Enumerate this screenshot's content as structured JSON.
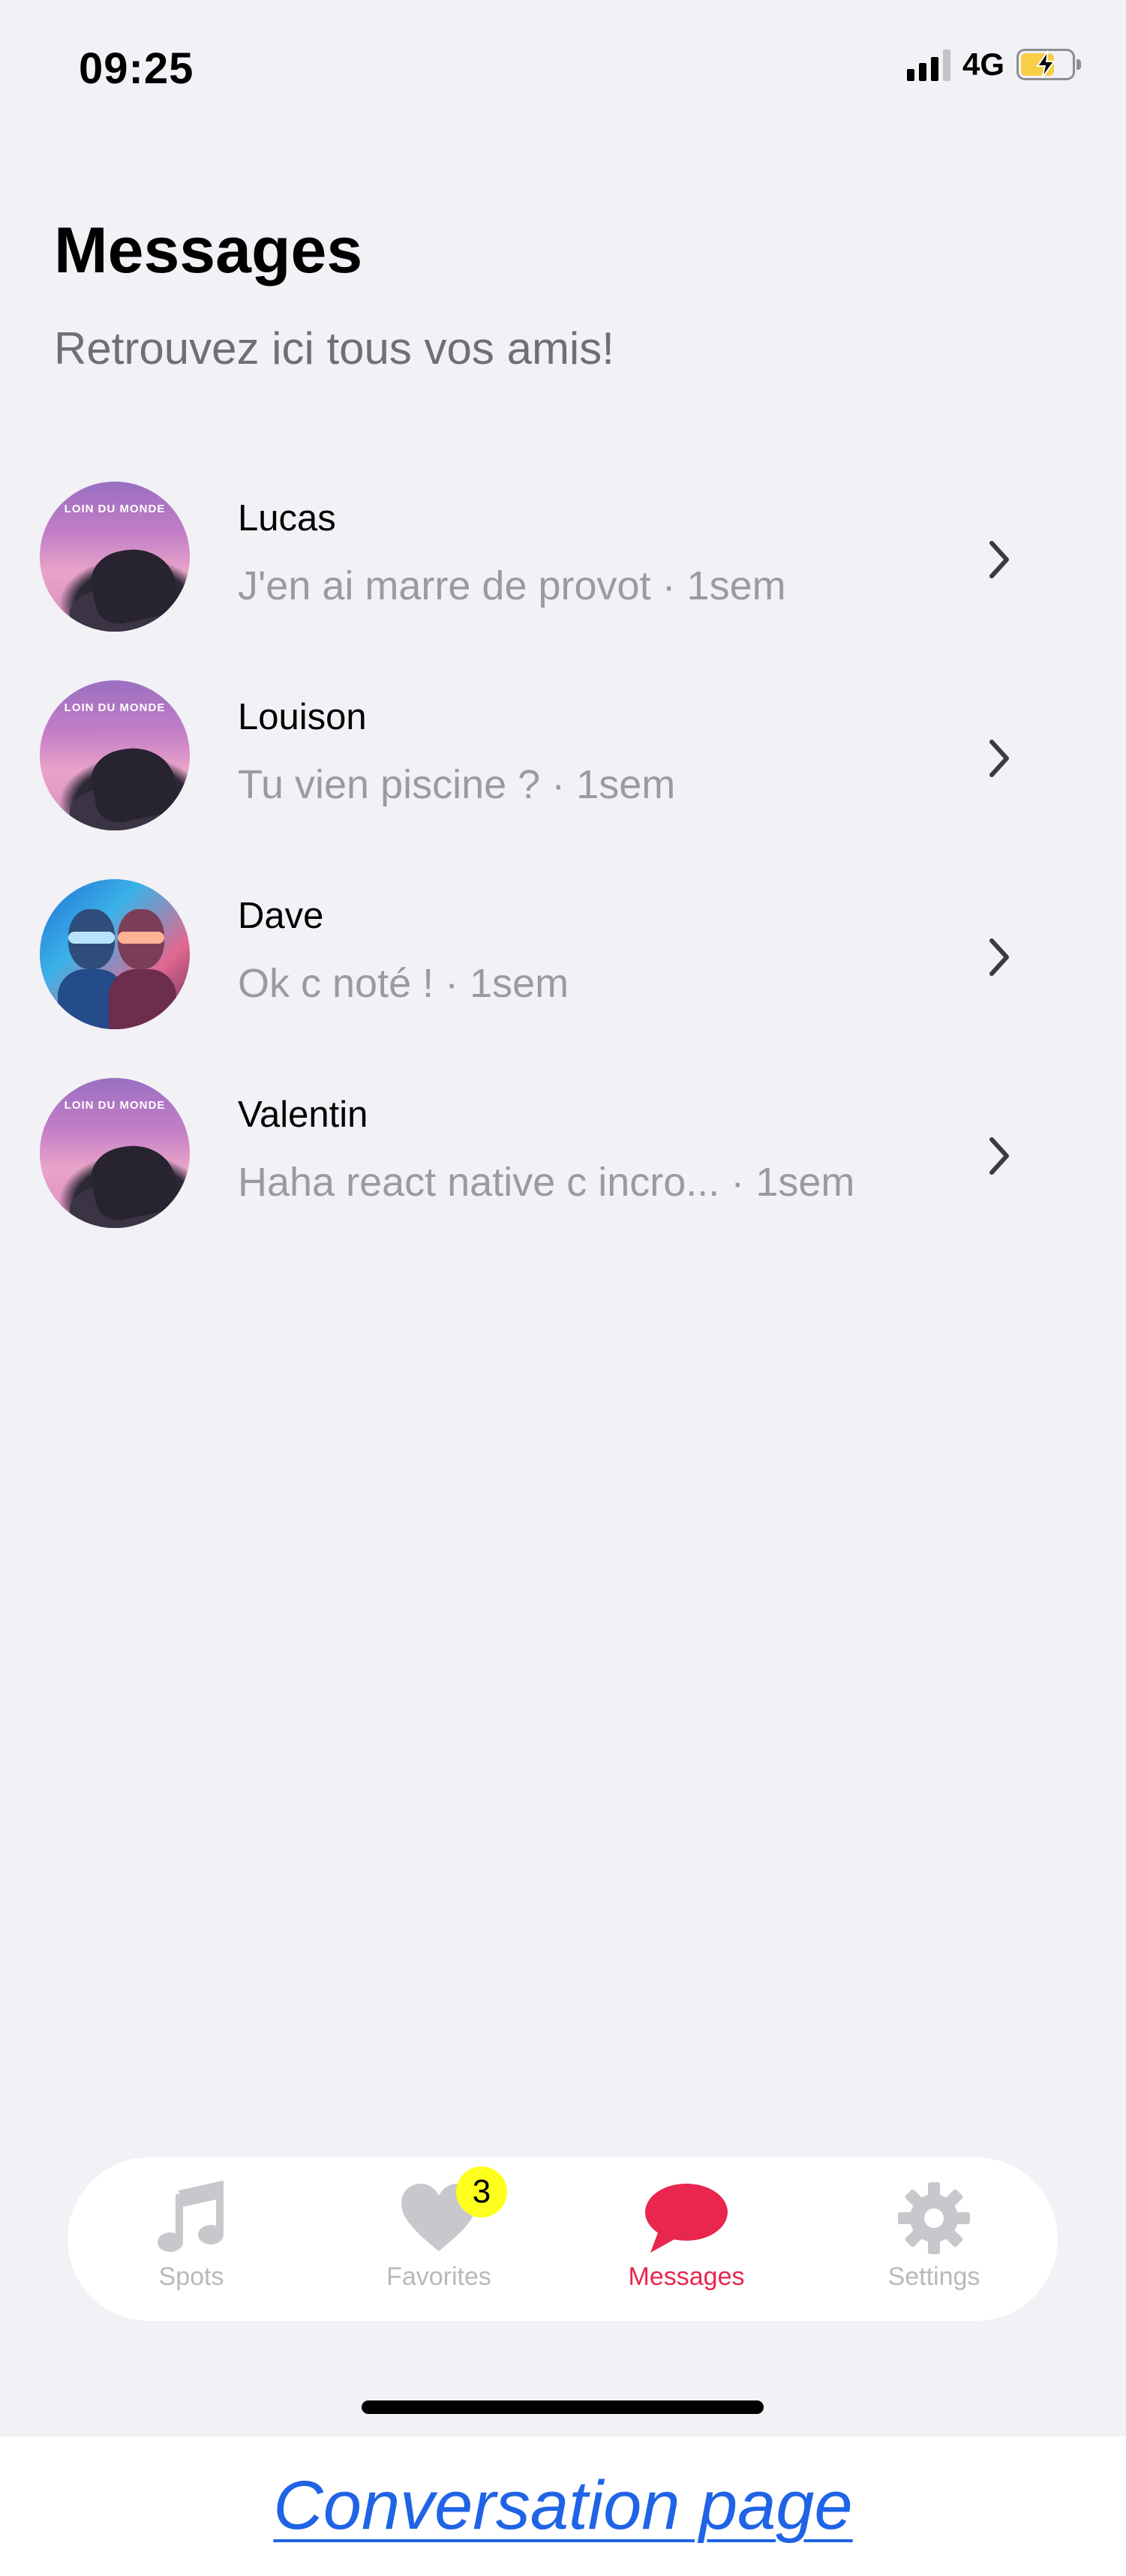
{
  "status_bar": {
    "time": "09:25",
    "network": "4G",
    "signal_bars_active": 3,
    "battery_charging": true
  },
  "header": {
    "title": "Messages",
    "subtitle": "Retrouvez ici tous vos amis!"
  },
  "conversations": [
    {
      "name": "Lucas",
      "preview": "J'en ai marre de provot · 1sem",
      "avatar": "album-cover"
    },
    {
      "name": "Louison",
      "preview": "Tu vien piscine ? · 1sem",
      "avatar": "album-cover"
    },
    {
      "name": "Dave",
      "preview": "Ok c noté ! · 1sem",
      "avatar": "duo-photo"
    },
    {
      "name": "Valentin",
      "preview": "Haha react native c incro...  · 1sem",
      "avatar": "album-cover"
    }
  ],
  "album_cover_text": "LOIN DU MONDE",
  "tab_bar": {
    "tabs": [
      {
        "label": "Spots",
        "icon": "music-note-icon",
        "active": false
      },
      {
        "label": "Favorites",
        "icon": "heart-icon",
        "active": false,
        "badge": "3"
      },
      {
        "label": "Messages",
        "icon": "chat-bubble-icon",
        "active": true
      },
      {
        "label": "Settings",
        "icon": "gear-icon",
        "active": false
      }
    ]
  },
  "colors": {
    "accent": "#e8264e",
    "inactive": "#b9b9bd",
    "badge": "#ffff1e",
    "background": "#f1f1f6"
  },
  "caption": "Conversation page"
}
